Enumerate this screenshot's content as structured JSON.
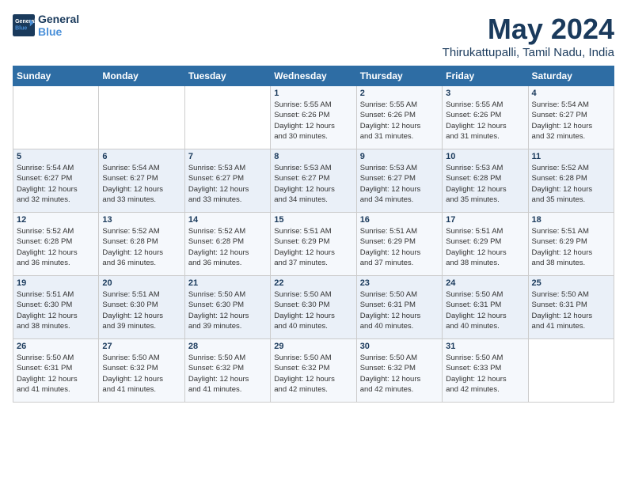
{
  "logo": {
    "line1": "General",
    "line2": "Blue"
  },
  "title": "May 2024",
  "subtitle": "Thirukattupalli, Tamil Nadu, India",
  "days_of_week": [
    "Sunday",
    "Monday",
    "Tuesday",
    "Wednesday",
    "Thursday",
    "Friday",
    "Saturday"
  ],
  "weeks": [
    [
      {
        "day": "",
        "info": ""
      },
      {
        "day": "",
        "info": ""
      },
      {
        "day": "",
        "info": ""
      },
      {
        "day": "1",
        "info": "Sunrise: 5:55 AM\nSunset: 6:26 PM\nDaylight: 12 hours\nand 30 minutes."
      },
      {
        "day": "2",
        "info": "Sunrise: 5:55 AM\nSunset: 6:26 PM\nDaylight: 12 hours\nand 31 minutes."
      },
      {
        "day": "3",
        "info": "Sunrise: 5:55 AM\nSunset: 6:26 PM\nDaylight: 12 hours\nand 31 minutes."
      },
      {
        "day": "4",
        "info": "Sunrise: 5:54 AM\nSunset: 6:27 PM\nDaylight: 12 hours\nand 32 minutes."
      }
    ],
    [
      {
        "day": "5",
        "info": "Sunrise: 5:54 AM\nSunset: 6:27 PM\nDaylight: 12 hours\nand 32 minutes."
      },
      {
        "day": "6",
        "info": "Sunrise: 5:54 AM\nSunset: 6:27 PM\nDaylight: 12 hours\nand 33 minutes."
      },
      {
        "day": "7",
        "info": "Sunrise: 5:53 AM\nSunset: 6:27 PM\nDaylight: 12 hours\nand 33 minutes."
      },
      {
        "day": "8",
        "info": "Sunrise: 5:53 AM\nSunset: 6:27 PM\nDaylight: 12 hours\nand 34 minutes."
      },
      {
        "day": "9",
        "info": "Sunrise: 5:53 AM\nSunset: 6:27 PM\nDaylight: 12 hours\nand 34 minutes."
      },
      {
        "day": "10",
        "info": "Sunrise: 5:53 AM\nSunset: 6:28 PM\nDaylight: 12 hours\nand 35 minutes."
      },
      {
        "day": "11",
        "info": "Sunrise: 5:52 AM\nSunset: 6:28 PM\nDaylight: 12 hours\nand 35 minutes."
      }
    ],
    [
      {
        "day": "12",
        "info": "Sunrise: 5:52 AM\nSunset: 6:28 PM\nDaylight: 12 hours\nand 36 minutes."
      },
      {
        "day": "13",
        "info": "Sunrise: 5:52 AM\nSunset: 6:28 PM\nDaylight: 12 hours\nand 36 minutes."
      },
      {
        "day": "14",
        "info": "Sunrise: 5:52 AM\nSunset: 6:28 PM\nDaylight: 12 hours\nand 36 minutes."
      },
      {
        "day": "15",
        "info": "Sunrise: 5:51 AM\nSunset: 6:29 PM\nDaylight: 12 hours\nand 37 minutes."
      },
      {
        "day": "16",
        "info": "Sunrise: 5:51 AM\nSunset: 6:29 PM\nDaylight: 12 hours\nand 37 minutes."
      },
      {
        "day": "17",
        "info": "Sunrise: 5:51 AM\nSunset: 6:29 PM\nDaylight: 12 hours\nand 38 minutes."
      },
      {
        "day": "18",
        "info": "Sunrise: 5:51 AM\nSunset: 6:29 PM\nDaylight: 12 hours\nand 38 minutes."
      }
    ],
    [
      {
        "day": "19",
        "info": "Sunrise: 5:51 AM\nSunset: 6:30 PM\nDaylight: 12 hours\nand 38 minutes."
      },
      {
        "day": "20",
        "info": "Sunrise: 5:51 AM\nSunset: 6:30 PM\nDaylight: 12 hours\nand 39 minutes."
      },
      {
        "day": "21",
        "info": "Sunrise: 5:50 AM\nSunset: 6:30 PM\nDaylight: 12 hours\nand 39 minutes."
      },
      {
        "day": "22",
        "info": "Sunrise: 5:50 AM\nSunset: 6:30 PM\nDaylight: 12 hours\nand 40 minutes."
      },
      {
        "day": "23",
        "info": "Sunrise: 5:50 AM\nSunset: 6:31 PM\nDaylight: 12 hours\nand 40 minutes."
      },
      {
        "day": "24",
        "info": "Sunrise: 5:50 AM\nSunset: 6:31 PM\nDaylight: 12 hours\nand 40 minutes."
      },
      {
        "day": "25",
        "info": "Sunrise: 5:50 AM\nSunset: 6:31 PM\nDaylight: 12 hours\nand 41 minutes."
      }
    ],
    [
      {
        "day": "26",
        "info": "Sunrise: 5:50 AM\nSunset: 6:31 PM\nDaylight: 12 hours\nand 41 minutes."
      },
      {
        "day": "27",
        "info": "Sunrise: 5:50 AM\nSunset: 6:32 PM\nDaylight: 12 hours\nand 41 minutes."
      },
      {
        "day": "28",
        "info": "Sunrise: 5:50 AM\nSunset: 6:32 PM\nDaylight: 12 hours\nand 41 minutes."
      },
      {
        "day": "29",
        "info": "Sunrise: 5:50 AM\nSunset: 6:32 PM\nDaylight: 12 hours\nand 42 minutes."
      },
      {
        "day": "30",
        "info": "Sunrise: 5:50 AM\nSunset: 6:32 PM\nDaylight: 12 hours\nand 42 minutes."
      },
      {
        "day": "31",
        "info": "Sunrise: 5:50 AM\nSunset: 6:33 PM\nDaylight: 12 hours\nand 42 minutes."
      },
      {
        "day": "",
        "info": ""
      }
    ]
  ]
}
